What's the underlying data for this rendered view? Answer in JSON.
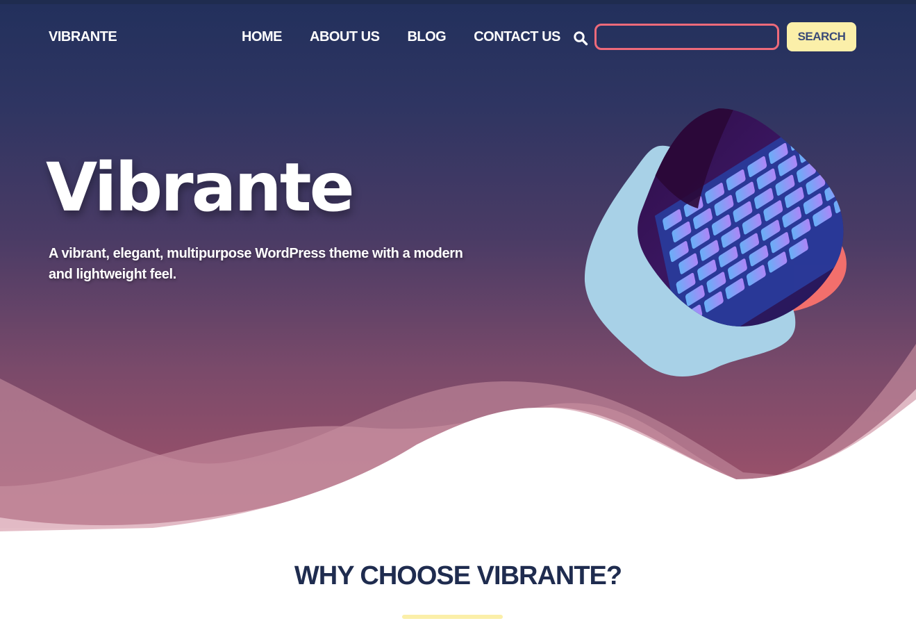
{
  "brand": {
    "name": "VIBRANTE"
  },
  "nav": {
    "items": [
      {
        "label": "HOME"
      },
      {
        "label": "ABOUT US"
      },
      {
        "label": "BLOG"
      },
      {
        "label": "CONTACT US"
      }
    ]
  },
  "search": {
    "icon": "search-icon",
    "value": "",
    "placeholder": "",
    "button_label": "SEARCH"
  },
  "hero": {
    "title": "Vibrante",
    "subtitle": "A vibrant, elegant, multipurpose WordPress theme with a modern and lightweight feel.",
    "image": "keyboard-photo"
  },
  "section": {
    "title": "WHY CHOOSE VIBRANTE?"
  },
  "colors": {
    "navy": "#1f2c4f",
    "accent_coral": "#ee6a7a",
    "accent_yellow": "#fbefa9",
    "accent_blue": "#a8d1e7",
    "blob_coral": "#f26f6c"
  }
}
